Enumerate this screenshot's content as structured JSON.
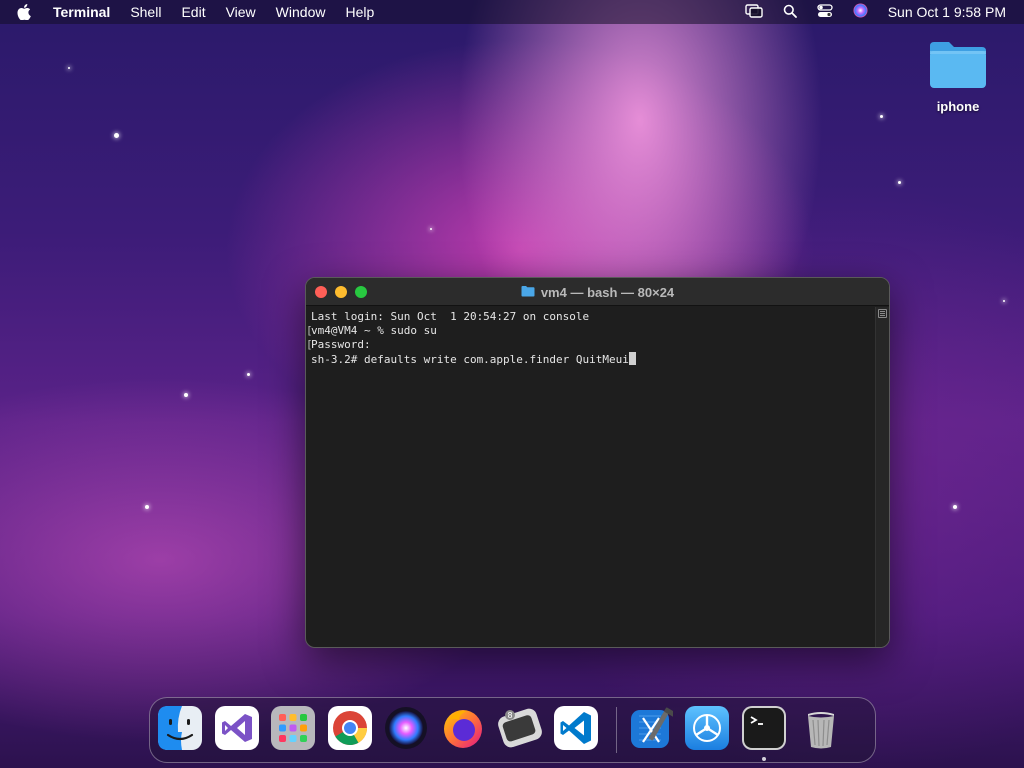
{
  "menubar": {
    "app_name": "Terminal",
    "menus": [
      "Shell",
      "Edit",
      "View",
      "Window",
      "Help"
    ],
    "clock": "Sun Oct 1  9:58 PM",
    "status_icons": [
      "window-stack-icon",
      "search-icon",
      "control-center-icon",
      "siri-icon"
    ]
  },
  "desktop": {
    "folder_label": "iphone"
  },
  "terminal": {
    "title": "vm4 — bash — 80×24",
    "lines": [
      "Last login: Sun Oct  1 20:54:27 on console",
      "vm4@VM4 ~ % sudo su",
      "Password:",
      "sh-3.2# defaults write com.apple.finder QuitMeui"
    ]
  },
  "dock": {
    "apps": [
      {
        "name": "finder-icon",
        "color": "#1e8cf0"
      },
      {
        "name": "visual-studio-icon",
        "color": "#7b52c6"
      },
      {
        "name": "launchpad-icon",
        "color": "#8a8a8a"
      },
      {
        "name": "chrome-icon",
        "color": "#db4437"
      },
      {
        "name": "siri-icon",
        "color": "#2a1b40"
      },
      {
        "name": "firefox-icon",
        "color": "#ff7139"
      },
      {
        "name": "vmware-icon",
        "color": "#555555"
      },
      {
        "name": "vscode-icon",
        "color": "#007acc"
      },
      {
        "name": "xcode-icon",
        "color": "#1d78d8"
      },
      {
        "name": "testflight-icon",
        "color": "#2b9cf2"
      },
      {
        "name": "terminal-icon",
        "color": "#1a1a1a"
      },
      {
        "name": "trash-icon",
        "color": "#9a9a9a"
      }
    ]
  }
}
